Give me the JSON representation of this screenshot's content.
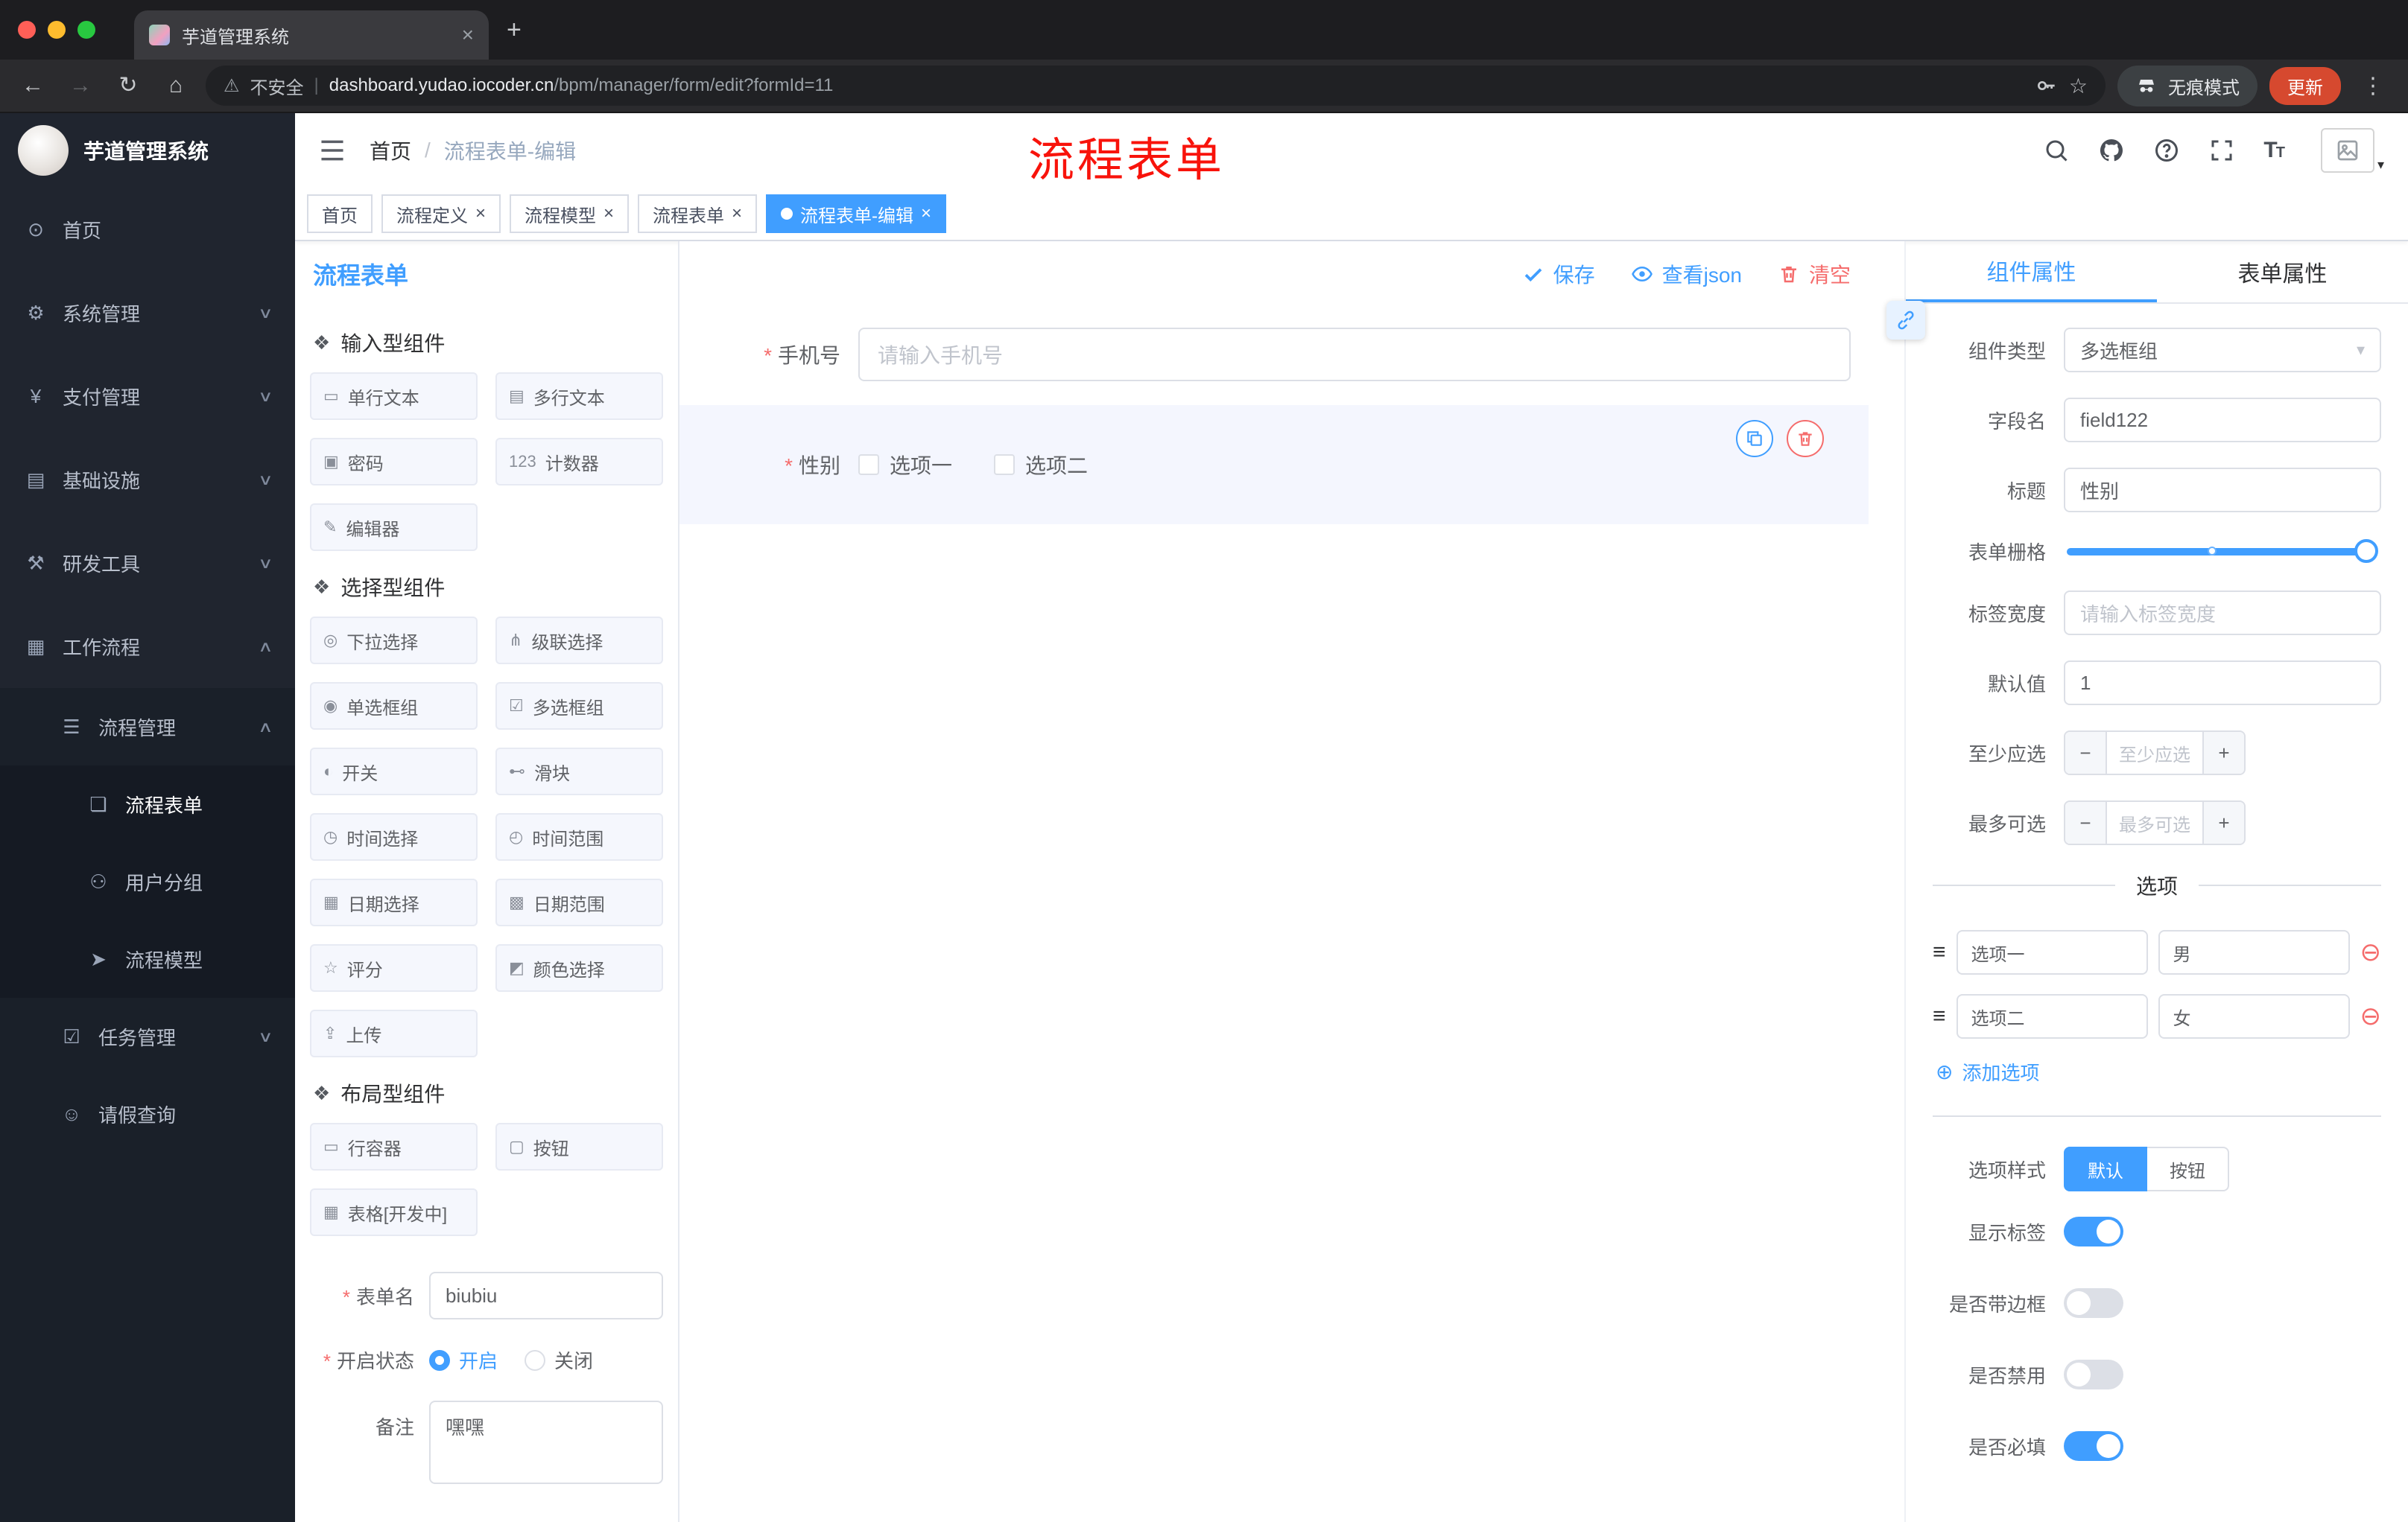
{
  "colors": {
    "accent": "#409eff",
    "danger": "#f56c6c",
    "annotation": "#f8130b",
    "sidebar_bg": "#20252f"
  },
  "browser": {
    "tab_title": "芋道管理系统",
    "security_label": "不安全",
    "url_domain": "dashboard.yudao.iocoder.cn",
    "url_path": "/bpm/manager/form/edit?formId=11",
    "incognito_label": "无痕模式",
    "update_label": "更新",
    "icon_names": [
      "back-icon",
      "forward-icon",
      "reload-icon",
      "home-icon",
      "warning-icon",
      "key-icon",
      "star-icon",
      "incognito-icon",
      "kebab-menu-icon"
    ]
  },
  "sidebar": {
    "logo_title": "芋道管理系统",
    "items": [
      {
        "name": "home",
        "label": "首页",
        "icon": "dashboard-icon",
        "glyph": "⊙",
        "level": 1
      },
      {
        "name": "system-management",
        "label": "系统管理",
        "icon": "gear-icon",
        "glyph": "⚙",
        "level": 1,
        "arrow": "down"
      },
      {
        "name": "payment-management",
        "label": "支付管理",
        "icon": "payment-icon",
        "glyph": "¥",
        "level": 1,
        "arrow": "down"
      },
      {
        "name": "infrastructure",
        "label": "基础设施",
        "icon": "infrastructure-icon",
        "glyph": "▤",
        "level": 1,
        "arrow": "down"
      },
      {
        "name": "dev-tools",
        "label": "研发工具",
        "icon": "devtools-icon",
        "glyph": "⚒",
        "level": 1,
        "arrow": "down"
      },
      {
        "name": "workflow",
        "label": "工作流程",
        "icon": "workflow-icon",
        "glyph": "▦",
        "level": 1,
        "arrow": "up"
      },
      {
        "name": "process-management",
        "label": "流程管理",
        "icon": "process-management-icon",
        "glyph": "☰",
        "level": 2,
        "arrow": "up"
      },
      {
        "name": "process-form",
        "label": "流程表单",
        "icon": "process-form-icon",
        "glyph": "❏",
        "level": 3,
        "active": true
      },
      {
        "name": "user-group",
        "label": "用户分组",
        "icon": "user-group-icon",
        "glyph": "⚇",
        "level": 3
      },
      {
        "name": "process-model",
        "label": "流程模型",
        "icon": "process-model-icon",
        "glyph": "➤",
        "level": 3
      },
      {
        "name": "task-management",
        "label": "任务管理",
        "icon": "task-management-icon",
        "glyph": "☑",
        "level": 2,
        "arrow": "down"
      },
      {
        "name": "leave-query",
        "label": "请假查询",
        "icon": "leave-query-icon",
        "glyph": "☺",
        "level": 2
      }
    ]
  },
  "header": {
    "breadcrumb": [
      "首页",
      "流程表单-编辑"
    ],
    "annotation": "流程表单",
    "icon_names": [
      "search-icon",
      "github-icon",
      "question-icon",
      "fullscreen-icon",
      "font-size-icon",
      "avatar"
    ]
  },
  "tags": [
    {
      "name": "home",
      "label": "首页",
      "closable": false,
      "active": false
    },
    {
      "name": "process-definition",
      "label": "流程定义",
      "closable": true,
      "active": false
    },
    {
      "name": "process-model",
      "label": "流程模型",
      "closable": true,
      "active": false
    },
    {
      "name": "process-form",
      "label": "流程表单",
      "closable": true,
      "active": false
    },
    {
      "name": "process-form-edit",
      "label": "流程表单-编辑",
      "closable": true,
      "active": true
    }
  ],
  "designer": {
    "title": "流程表单",
    "toolbar": {
      "save": "保存",
      "view_json": "查看json",
      "clear": "清空"
    },
    "palette": {
      "group_icon": "❖",
      "groups": [
        {
          "title": "输入型组件",
          "items": [
            {
              "label": "单行文本",
              "icon": "single-line-text-icon",
              "glyph": "▭"
            },
            {
              "label": "多行文本",
              "icon": "multi-line-text-icon",
              "glyph": "▤"
            },
            {
              "label": "密码",
              "icon": "password-icon",
              "glyph": "▣"
            },
            {
              "label": "计数器",
              "icon": "counter-icon",
              "glyph": "123"
            },
            {
              "label": "编辑器",
              "icon": "editor-icon",
              "glyph": "✎"
            }
          ]
        },
        {
          "title": "选择型组件",
          "items": [
            {
              "label": "下拉选择",
              "icon": "select-icon",
              "glyph": "◎"
            },
            {
              "label": "级联选择",
              "icon": "cascader-icon",
              "glyph": "⋔"
            },
            {
              "label": "单选框组",
              "icon": "radio-group-icon",
              "glyph": "◉"
            },
            {
              "label": "多选框组",
              "icon": "checkbox-group-icon",
              "glyph": "☑"
            },
            {
              "label": "开关",
              "icon": "switch-icon",
              "glyph": "◐"
            },
            {
              "label": "滑块",
              "icon": "slider-icon",
              "glyph": "⊷"
            },
            {
              "label": "时间选择",
              "icon": "time-picker-icon",
              "glyph": "◷"
            },
            {
              "label": "时间范围",
              "icon": "time-range-icon",
              "glyph": "◴"
            },
            {
              "label": "日期选择",
              "icon": "date-picker-icon",
              "glyph": "▦"
            },
            {
              "label": "日期范围",
              "icon": "date-range-icon",
              "glyph": "▩"
            },
            {
              "label": "评分",
              "icon": "rate-icon",
              "glyph": "☆"
            },
            {
              "label": "颜色选择",
              "icon": "color-picker-icon",
              "glyph": "◩"
            },
            {
              "label": "上传",
              "icon": "upload-icon",
              "glyph": "⇪"
            }
          ]
        },
        {
          "title": "布局型组件",
          "items": [
            {
              "label": "行容器",
              "icon": "row-container-icon",
              "glyph": "▭"
            },
            {
              "label": "按钮",
              "icon": "button-icon",
              "glyph": "▢"
            },
            {
              "label": "表格[开发中]",
              "icon": "table-icon",
              "glyph": "▦"
            }
          ]
        }
      ]
    },
    "form_settings": {
      "name_label": "表单名",
      "name_value": "biubiu",
      "status_label": "开启状态",
      "status_on": "开启",
      "status_off": "关闭",
      "status_selected": "开启",
      "remark_label": "备注",
      "remark_value": "嘿嘿"
    },
    "canvas": {
      "phone": {
        "label": "手机号",
        "required": true,
        "placeholder": "请输入手机号"
      },
      "gender": {
        "label": "性别",
        "required": true,
        "selected": true,
        "options": [
          "选项一",
          "选项二"
        ]
      }
    },
    "properties": {
      "tab_component": "组件属性",
      "tab_form": "表单属性",
      "active_tab": "组件属性",
      "component_type": {
        "label": "组件类型",
        "value": "多选框组"
      },
      "field_name": {
        "label": "字段名",
        "value": "field122"
      },
      "title": {
        "label": "标题",
        "value": "性别"
      },
      "grid": {
        "label": "表单栅格"
      },
      "label_width": {
        "label": "标签宽度",
        "placeholder": "请输入标签宽度"
      },
      "default_value": {
        "label": "默认值",
        "value": "1"
      },
      "min_select": {
        "label": "至少应选",
        "placeholder": "至少应选"
      },
      "max_select": {
        "label": "最多可选",
        "placeholder": "最多可选"
      },
      "options_title": "选项",
      "options": [
        {
          "label": "选项一",
          "value": "男"
        },
        {
          "label": "选项二",
          "value": "女"
        }
      ],
      "add_option": "添加选项",
      "option_style": {
        "label": "选项样式",
        "options": [
          "默认",
          "按钮"
        ],
        "selected": "默认"
      },
      "switches": [
        {
          "name": "show-label",
          "label": "显示标签",
          "on": true
        },
        {
          "name": "border",
          "label": "是否带边框",
          "on": false
        },
        {
          "name": "disabled",
          "label": "是否禁用",
          "on": false
        },
        {
          "name": "required",
          "label": "是否必填",
          "on": true
        }
      ]
    }
  }
}
